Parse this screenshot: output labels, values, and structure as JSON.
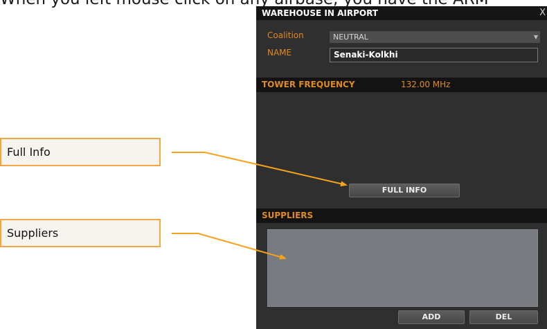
{
  "caption": "When you left mouse click on any airbase, you have the ARM",
  "panel": {
    "title": "WAREHOUSE IN AIRPORT",
    "close_glyph": "X",
    "coalition_label": "Coalition",
    "coalition_value": "NEUTRAL",
    "name_label": "NAME",
    "name_value": "Senaki-Kolkhi",
    "tower_frequency_label": "TOWER FREQUENCY",
    "tower_frequency_value": "132.00 MHz",
    "full_info_button": "FULL INFO",
    "suppliers_label": "SUPPLIERS",
    "add_button": "ADD",
    "del_button": "DEL"
  },
  "callouts": {
    "full_info": "Full Info",
    "suppliers": "Suppliers"
  },
  "colors": {
    "accent": "#e08a20",
    "callout_border": "#f2a541",
    "arrow": "#f7a21b"
  },
  "icons": {
    "close": "close-icon",
    "dropdown": "chevron-down-icon"
  }
}
